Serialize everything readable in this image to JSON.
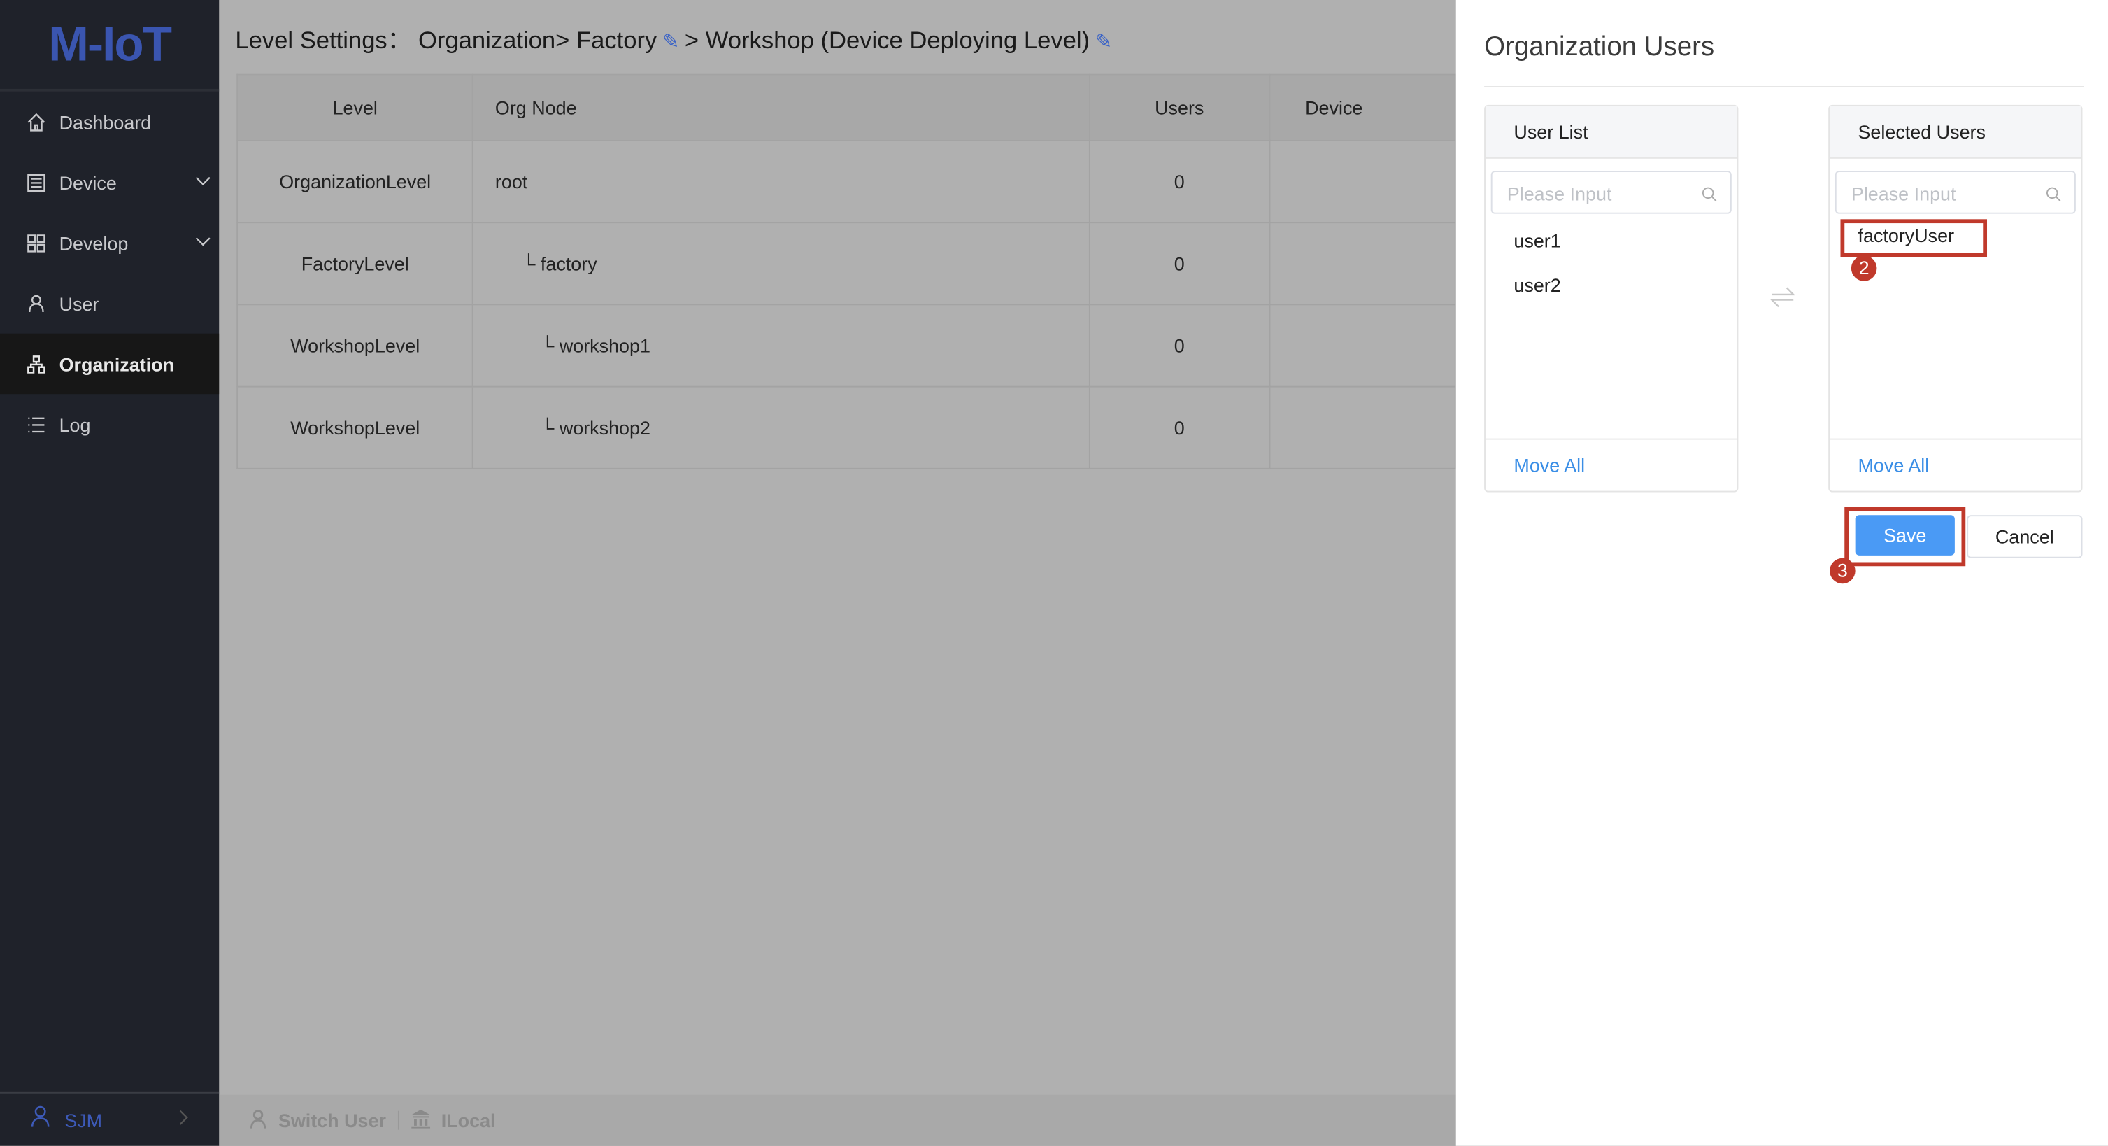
{
  "app": {
    "logo": "M-IoT"
  },
  "sidebar": {
    "items": [
      {
        "label": "Dashboard",
        "icon": "home-icon"
      },
      {
        "label": "Device",
        "icon": "device-icon",
        "expandable": true
      },
      {
        "label": "Develop",
        "icon": "grid-icon",
        "expandable": true
      },
      {
        "label": "User",
        "icon": "user-icon"
      },
      {
        "label": "Organization",
        "icon": "org-tree-icon",
        "active": true
      },
      {
        "label": "Log",
        "icon": "list-icon"
      }
    ],
    "user": "SJM"
  },
  "breadcrumb": {
    "prefix": "Level Settings：",
    "part1": "Organization> Factory",
    "part2": "> Workshop (Device Deploying Level)"
  },
  "table": {
    "headers": [
      "Level",
      "Org Node",
      "Users",
      "Device"
    ],
    "rows": [
      {
        "level": "OrganizationLevel",
        "node": "root",
        "users": "0"
      },
      {
        "level": "FactoryLevel",
        "node": "factory",
        "users": "0"
      },
      {
        "level": "WorkshopLevel",
        "node": "workshop1",
        "users": "0"
      },
      {
        "level": "WorkshopLevel",
        "node": "workshop2",
        "users": "0"
      }
    ]
  },
  "footer": {
    "switch_user": "Switch User",
    "local": "ILocal"
  },
  "drawer": {
    "title": "Organization Users",
    "left": {
      "title": "User List",
      "placeholder": "Please Input",
      "items": [
        "user1",
        "user2"
      ],
      "move_all": "Move All"
    },
    "right": {
      "title": "Selected Users",
      "placeholder": "Please Input",
      "items": [
        "factoryUser"
      ],
      "move_all": "Move All"
    },
    "save": "Save",
    "cancel": "Cancel",
    "annotations": [
      "2",
      "3"
    ]
  },
  "colors": {
    "accent": "#4a9af5",
    "highlight": "#c0392b",
    "sidebar": "#1f222a",
    "logo": "#3a55b0"
  }
}
